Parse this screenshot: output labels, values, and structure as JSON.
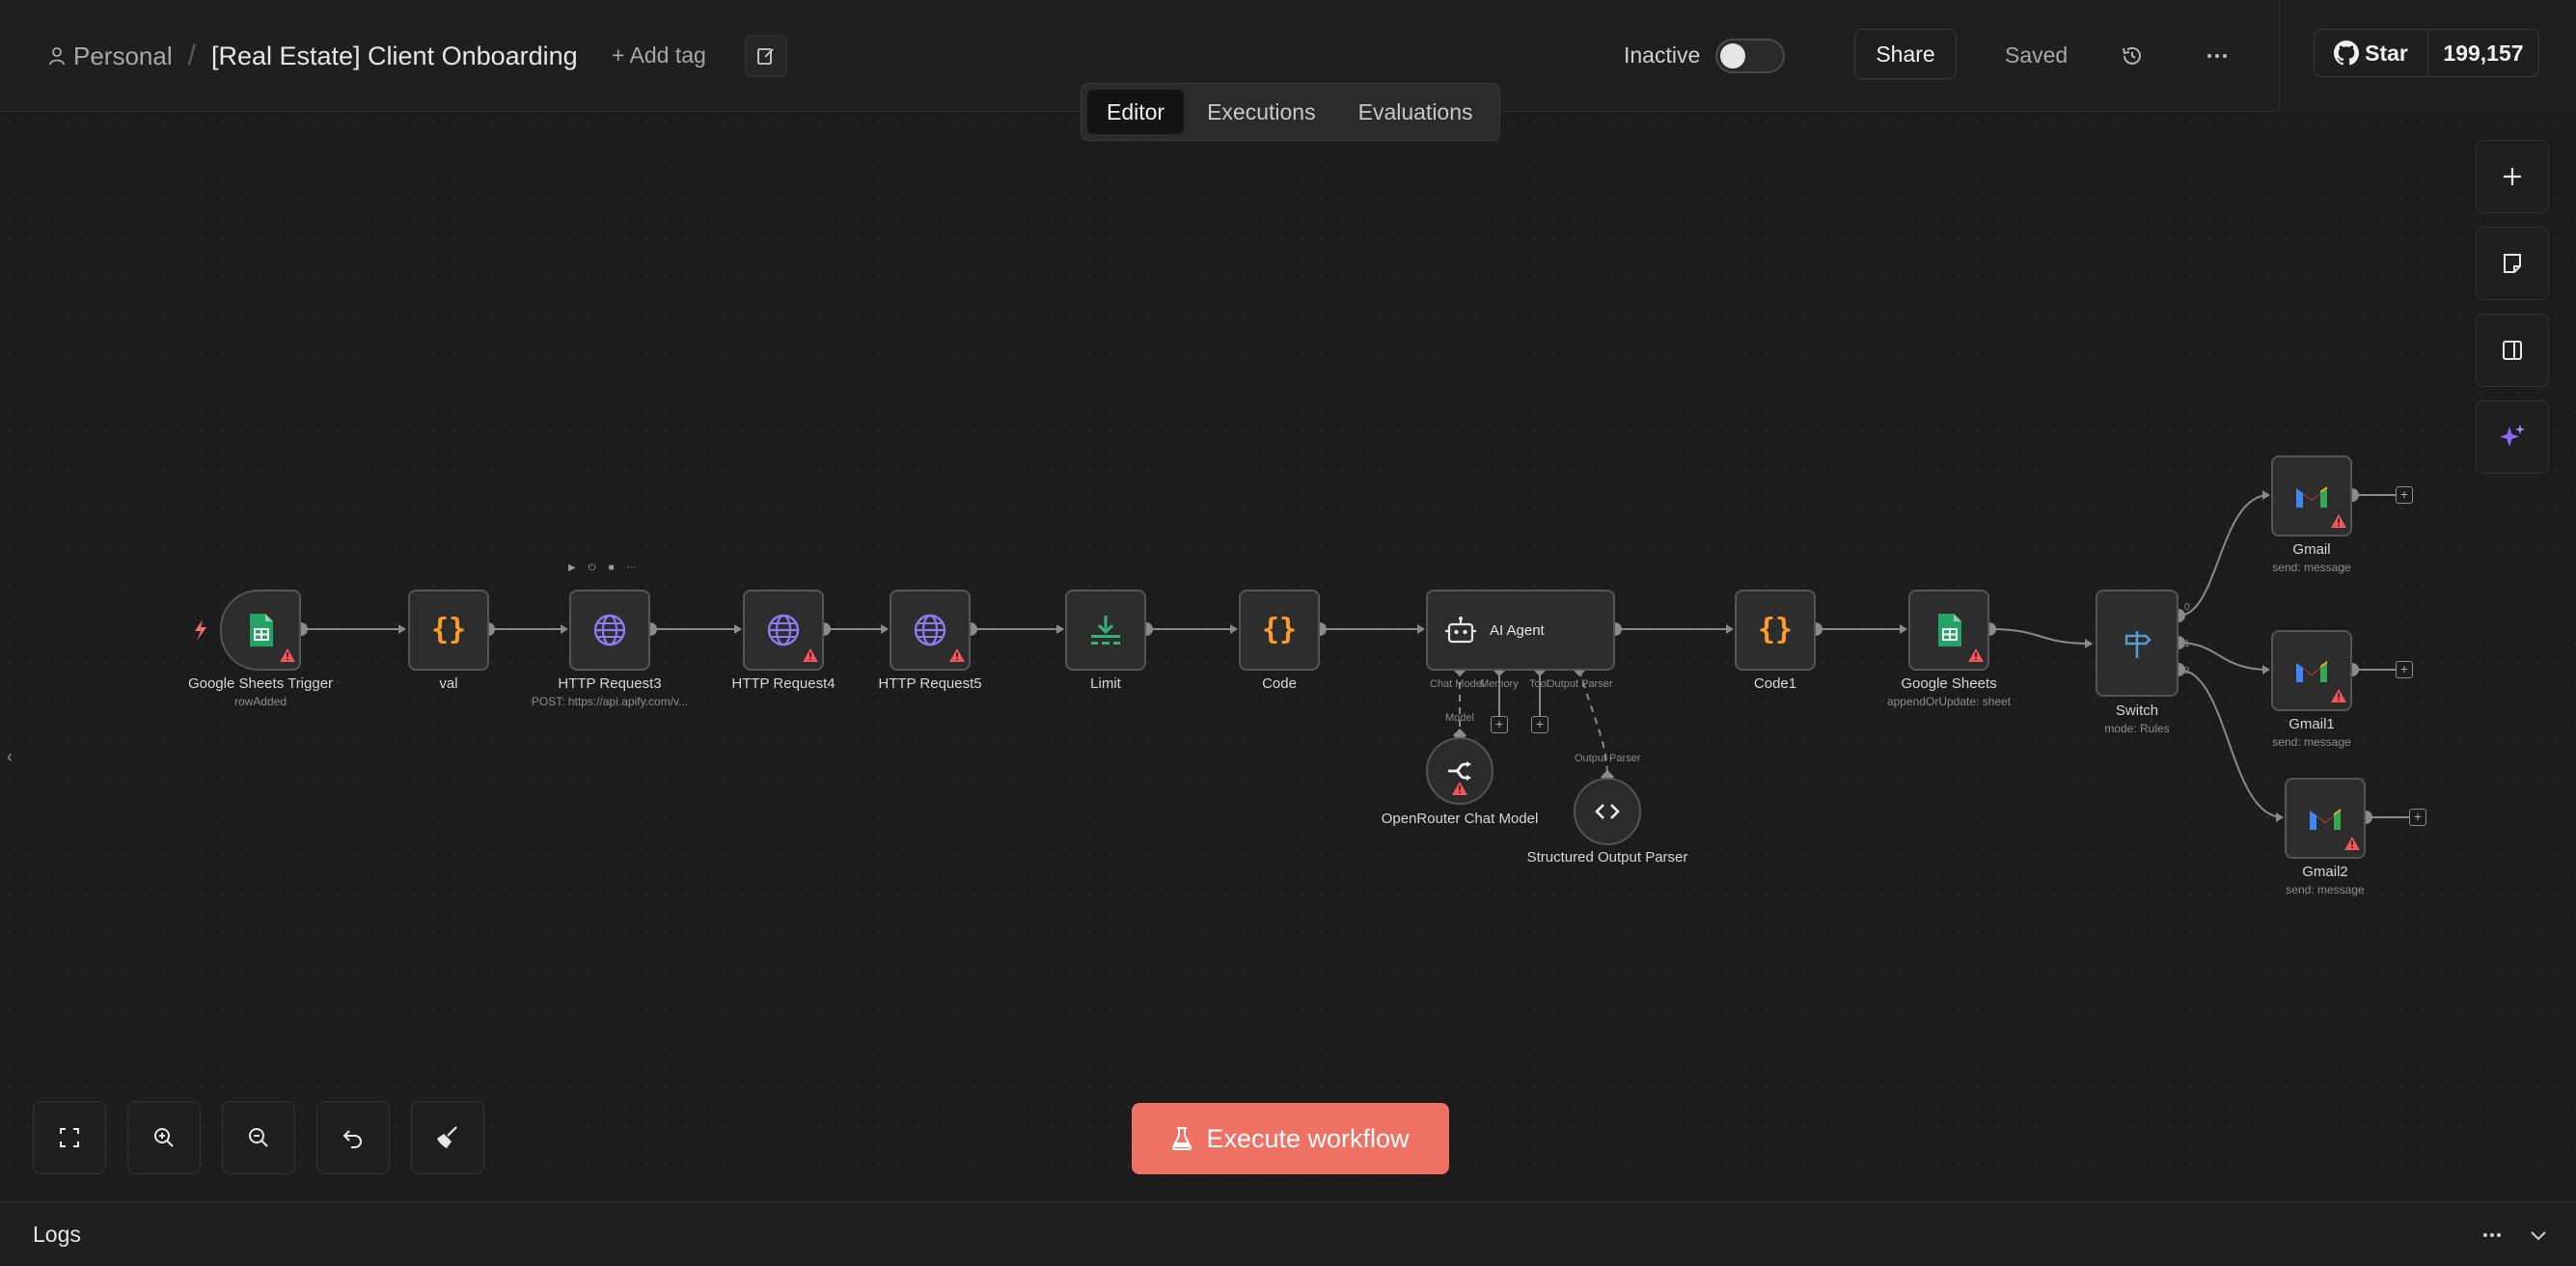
{
  "header": {
    "project": "Personal",
    "separator": "/",
    "workflow_name": "[Real Estate] Client Onboarding",
    "add_tag": "+ Add tag",
    "status_label": "Inactive",
    "share": "Share",
    "saved": "Saved",
    "github_star": "Star",
    "github_count": "199,157"
  },
  "tabs": [
    "Editor",
    "Executions",
    "Evaluations"
  ],
  "active_tab": "Editor",
  "nodes": {
    "sheets_trigger": {
      "name": "Google Sheets Trigger",
      "sub": "rowAdded",
      "icon": "google-sheets-icon"
    },
    "val": {
      "name": "val",
      "icon": "code-braces-icon"
    },
    "http3": {
      "name": "HTTP Request3",
      "sub": "POST: https://api.apify.com/v...",
      "icon": "globe-icon"
    },
    "http4": {
      "name": "HTTP Request4",
      "icon": "globe-icon"
    },
    "http5": {
      "name": "HTTP Request5",
      "icon": "globe-icon"
    },
    "limit": {
      "name": "Limit",
      "icon": "limit-icon"
    },
    "code": {
      "name": "Code",
      "icon": "code-braces-icon"
    },
    "agent": {
      "name": "AI Agent",
      "icon": "robot-icon",
      "ports": [
        "Chat Model",
        "Memory",
        "Tool",
        "Output Parser"
      ]
    },
    "code1": {
      "name": "Code1",
      "icon": "code-braces-icon"
    },
    "sheets": {
      "name": "Google Sheets",
      "sub": "appendOrUpdate: sheet",
      "icon": "google-sheets-icon"
    },
    "switch": {
      "name": "Switch",
      "sub": "mode: Rules",
      "icon": "signpost-icon",
      "outputs": [
        "0",
        "1",
        "2"
      ]
    },
    "gmail": {
      "name": "Gmail",
      "sub": "send: message",
      "icon": "gmail-icon"
    },
    "gmail1": {
      "name": "Gmail1",
      "sub": "send: message",
      "icon": "gmail-icon"
    },
    "gmail2": {
      "name": "Gmail2",
      "sub": "send: message",
      "icon": "gmail-icon"
    },
    "openrouter": {
      "name": "OpenRouter Chat Model",
      "icon": "openrouter-icon",
      "edge_label": "Model"
    },
    "parser": {
      "name": "Structured Output Parser",
      "icon": "code-brackets-icon",
      "edge_label": "Output Parser"
    }
  },
  "execute_button": "Execute workflow",
  "logs": {
    "title": "Logs"
  },
  "colors": {
    "accent": "#ee7163",
    "warning": "#f2555a",
    "sheets_green": "#21a464",
    "code_orange": "#ff9b26",
    "http_purple": "#8c7cf0",
    "limit_green": "#34b27b",
    "switch_blue": "#5b9bd5"
  }
}
